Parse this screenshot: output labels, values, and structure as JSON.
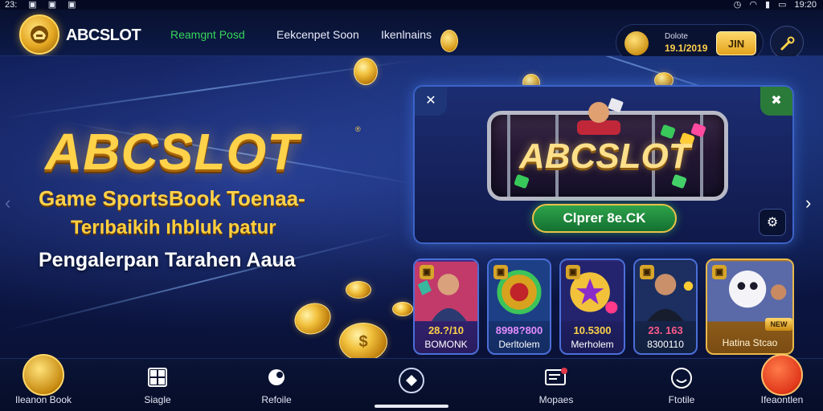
{
  "status_bar": {
    "left_text": "23:",
    "right_time": "19:20"
  },
  "header": {
    "logo_text": "ABCSLOT",
    "nav": [
      {
        "label": "Reamgnt Posd",
        "active": true
      },
      {
        "label": "Eekcenpet Soon",
        "active": false
      },
      {
        "label": "Ikenlnains",
        "active": false
      }
    ],
    "wallet": {
      "label": "Dolote",
      "amount": "19.1/2019",
      "button_label": "JIN"
    },
    "colors": {
      "accent_green": "#35d65a",
      "gold": "#ffd24a"
    }
  },
  "hero": {
    "title": "ABCSLOT",
    "title_mark": "®",
    "subtitle_1": "Game SportsBook Toenaa-",
    "subtitle_2": "Terıbaikih ıhbluk patur",
    "subtitle_3": "Pengalerpan Tarahen Aaua",
    "slot_title": "ABCSLOT",
    "play_button": "Clprer 8e.CK",
    "cards": [
      {
        "amount": "28.?/10",
        "name": "BOMONK",
        "amount_color": "#ffd24a"
      },
      {
        "amount": "8998?800",
        "name": "Derltolem",
        "amount_color": "#e48cff"
      },
      {
        "amount": "10.5300",
        "name": "Merholem",
        "amount_color": "#ffd24a"
      },
      {
        "amount": "23. 163",
        "name": "8300110",
        "amount_color": "#ff5b8a"
      },
      {
        "amount": "",
        "name": "Hatina Stcao",
        "badge": "NEW",
        "amount_color": "#ffd24a"
      }
    ]
  },
  "bottom_nav": [
    {
      "label": "Ileanon Book",
      "icon": "trophy-icon"
    },
    {
      "label": "Siagle",
      "icon": "grid-icon"
    },
    {
      "label": "Refoile",
      "icon": "chat-icon"
    },
    {
      "label": "",
      "icon": "diamond-icon"
    },
    {
      "label": "Mopaes",
      "icon": "mail-icon"
    },
    {
      "label": "Ftotile",
      "icon": "profile-icon"
    },
    {
      "label": "Ifeaontlen",
      "icon": "support-icon"
    }
  ]
}
